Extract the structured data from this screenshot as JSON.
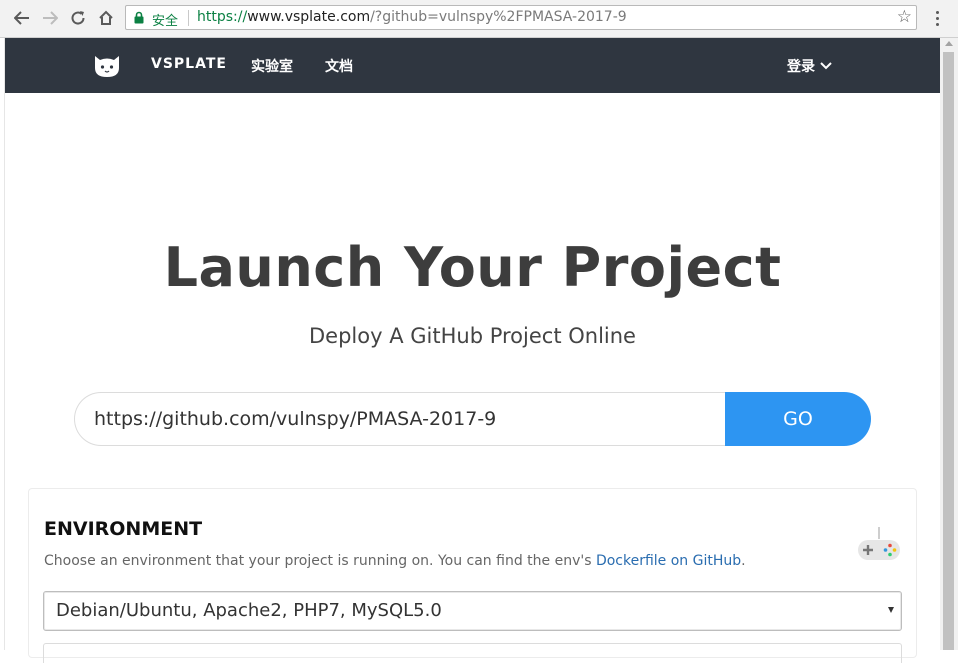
{
  "browser": {
    "secure_label": "安全",
    "url_scheme": "https://",
    "url_host": "www.vsplate.com",
    "url_rest": "/?github=vulnspy%2FPMASA-2017-9",
    "icons": [
      "back-arrow-icon",
      "forward-arrow-icon",
      "reload-icon",
      "home-icon",
      "lock-icon",
      "star-icon",
      "menu-dots-icon"
    ]
  },
  "header": {
    "brand": "VSPLATE",
    "nav": [
      "实验室",
      "文档"
    ],
    "login": "登录",
    "background": "#2f3640"
  },
  "hero": {
    "title": "Launch Your Project",
    "subtitle": "Deploy A GitHub Project Online",
    "repo_value": "https://github.com/vulnspy/PMASA-2017-9",
    "go_label": "GO",
    "accent": "#2d95f2"
  },
  "environment": {
    "title": "ENVIRONMENT",
    "desc_prefix": "Choose an environment that your project is running on. You can find the env's ",
    "desc_link": "Dockerfile on GitHub",
    "desc_suffix": ".",
    "selected": "Debian/Ubuntu, Apache2, PHP7, MySQL5.0",
    "link_color": "#2a6db0"
  }
}
